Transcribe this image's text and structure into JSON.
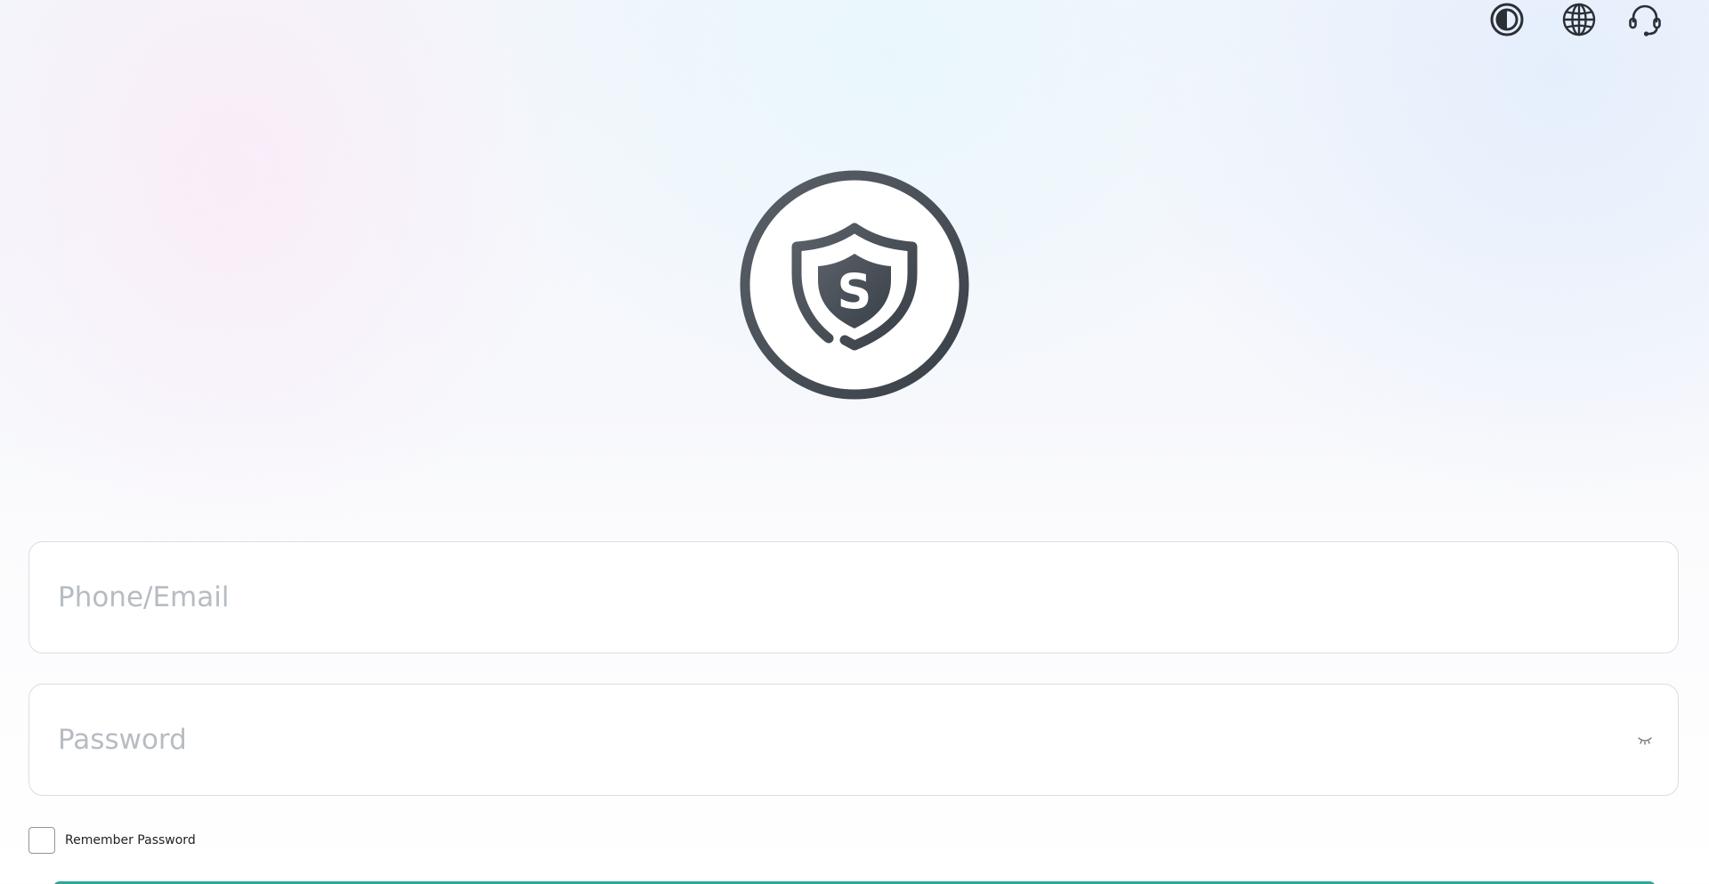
{
  "header": {
    "icons": {
      "theme": "contrast-icon",
      "language": "globe-icon",
      "support": "headset-icon"
    }
  },
  "logo": {
    "icon": "shield-s-logo",
    "letter": "S",
    "color": "#4a5058"
  },
  "form": {
    "phone_placeholder": "Phone/Email",
    "phone_value": "",
    "password_placeholder": "Password",
    "password_value": "",
    "password_toggle_icon": "eye-closed-icon",
    "remember_label": "Remember Password",
    "remember_checked": false
  },
  "colors": {
    "accent": "#2ea89a",
    "icon": "#2b2f36",
    "border": "#d9dde3",
    "placeholder": "#b7bcc3"
  }
}
